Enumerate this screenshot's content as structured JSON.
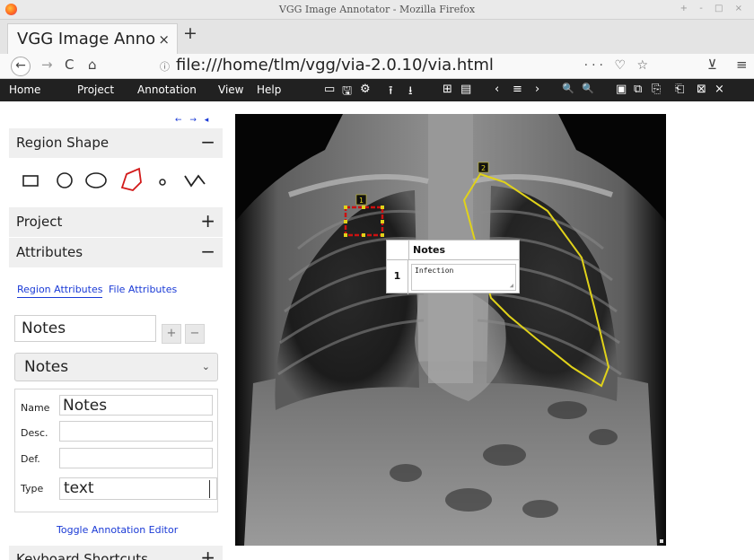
{
  "window": {
    "title": "VGG Image Annotator - Mozilla Firefox",
    "controls": "+ - □ ×"
  },
  "tabs": [
    {
      "label": "VGG Image Anno",
      "close": "×"
    }
  ],
  "new_tab": "+",
  "nav": {
    "back": "←",
    "forward": "→",
    "reload": "C",
    "home": "⌂",
    "info": "ⓘ",
    "url": "file:///home/tlm/vgg/via-2.0.10/via.html",
    "url_actions": "··· ♡ ☆",
    "ext": "⊻",
    "menu": "≡"
  },
  "menubar": {
    "items": [
      "Home",
      "Project",
      "Annotation",
      "View",
      "Help"
    ],
    "tools": [
      "▭",
      "🖫",
      "⚙",
      "⭱",
      "⭳",
      "⊞",
      "▤",
      "‹",
      "≡",
      "›",
      "🔍",
      "🔍",
      "▣",
      "⧉",
      "⎘",
      "⎗",
      "⊠",
      "×"
    ]
  },
  "sidebar": {
    "arrows": "← → ◂",
    "region_shape": {
      "label": "Region Shape",
      "toggle": "−"
    },
    "project": {
      "label": "Project",
      "toggle": "+"
    },
    "attributes": {
      "label": "Attributes",
      "toggle": "−"
    },
    "region_attributes_tab": "Region Attributes",
    "file_attributes_tab": "File Attributes",
    "new_attr_value": "Notes",
    "add_btn": "+",
    "remove_btn": "−",
    "attr_select": "Notes",
    "name_label": "Name",
    "name_value": "Notes",
    "desc_label": "Desc.",
    "def_label": "Def.",
    "type_label": "Type",
    "type_value": "text",
    "toggle_editor": "Toggle Annotation Editor",
    "keyboard": {
      "label": "Keyboard Shortcuts",
      "toggle": "+"
    }
  },
  "regions": [
    {
      "id": "1",
      "shape": "rect",
      "color": "#cc1111"
    },
    {
      "id": "2",
      "shape": "polygon",
      "color": "#e0d21a"
    }
  ],
  "popup": {
    "header": "Notes",
    "row_id": "1",
    "value": "Infection"
  },
  "colors": {
    "menubar": "#212121",
    "link": "#1a3ad6",
    "region1": "#cc1111",
    "region2": "#e0d21a"
  }
}
